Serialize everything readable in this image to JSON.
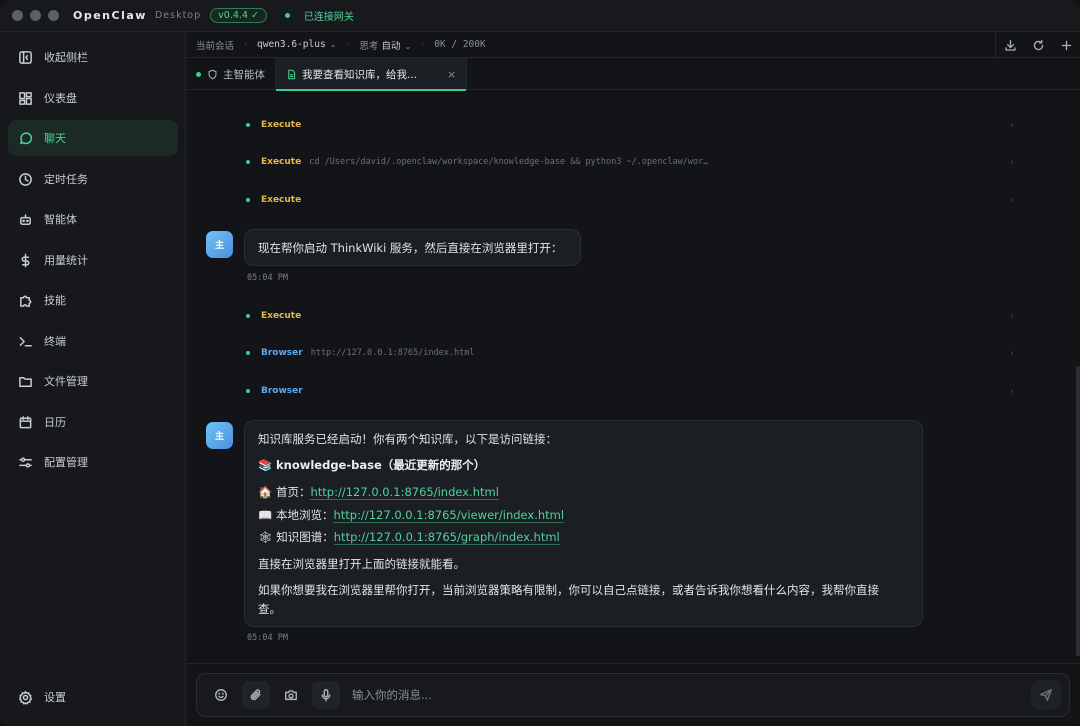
{
  "titlebar": {
    "app_name": "OpenClaw",
    "app_sub": "Desktop",
    "version": "v0.4.4 ✓",
    "gateway_status": "已连接网关"
  },
  "sidebar": {
    "items": [
      {
        "label": "收起侧栏",
        "icon": "collapse-sidebar-icon"
      },
      {
        "label": "仪表盘",
        "icon": "dashboard-icon"
      },
      {
        "label": "聊天",
        "icon": "chat-icon",
        "active": true
      },
      {
        "label": "定时任务",
        "icon": "clock-icon"
      },
      {
        "label": "智能体",
        "icon": "robot-icon"
      },
      {
        "label": "用量统计",
        "icon": "dollar-icon"
      },
      {
        "label": "技能",
        "icon": "puzzle-icon"
      },
      {
        "label": "终端",
        "icon": "terminal-icon"
      },
      {
        "label": "文件管理",
        "icon": "folder-icon"
      },
      {
        "label": "日历",
        "icon": "calendar-icon"
      },
      {
        "label": "配置管理",
        "icon": "sliders-icon"
      }
    ],
    "settings_label": "设置"
  },
  "toolbar": {
    "session_label": "当前会话",
    "model": "qwen3.6-plus",
    "think_label": "思考",
    "think_value": "自动",
    "tokens": "0K / 200K"
  },
  "tabs": [
    {
      "label": "主智能体",
      "icon": "shield-icon"
    },
    {
      "label": "我要查看知识库，给我...",
      "icon": "file-icon",
      "active": true,
      "close": "×"
    }
  ],
  "chat": {
    "tool_calls_1": [
      {
        "name": "Execute",
        "arg": ""
      },
      {
        "name": "Execute",
        "arg": "cd /Users/david/.openclaw/workspace/knowledge-base && python3 ~/.openclaw/wor…"
      },
      {
        "name": "Execute",
        "arg": ""
      }
    ],
    "avatar_label": "主",
    "message_1": {
      "text": "现在帮你启动 ThinkWiki 服务，然后直接在浏览器里打开：",
      "time": "05:04 PM"
    },
    "tool_calls_2": [
      {
        "name": "Execute",
        "arg": ""
      },
      {
        "name": "Browser",
        "arg": "http://127.0.0.1:8765/index.html"
      },
      {
        "name": "Browser",
        "arg": ""
      }
    ],
    "message_2": {
      "intro": "知识库服务已经启动！你有两个知识库，以下是访问链接：",
      "kb_emoji": "📚",
      "kb_name": "knowledge-base（最近更新的那个）",
      "links": [
        {
          "emoji": "🏠",
          "label": "首页：",
          "url": "http://127.0.0.1:8765/index.html"
        },
        {
          "emoji": "📖",
          "label": "本地浏览：",
          "url": "http://127.0.0.1:8765/viewer/index.html"
        },
        {
          "emoji": "🕸",
          "label": "知识图谱：",
          "url": "http://127.0.0.1:8765/graph/index.html"
        }
      ],
      "line_direct": "直接在浏览器里打开上面的链接就能看。",
      "line_help_1": "如果你想要我在浏览器里帮你打开，当前浏览器策略有限制，你可以自己点链接，或者告诉我你想看什么内容，我帮你直接",
      "line_help_2": "查。",
      "time": "05:04 PM"
    }
  },
  "composer": {
    "placeholder": "输入你的消息..."
  },
  "colors": {
    "accent": "#3ecf8e",
    "execute": "#e0b94a",
    "browser": "#5ea8f0"
  }
}
